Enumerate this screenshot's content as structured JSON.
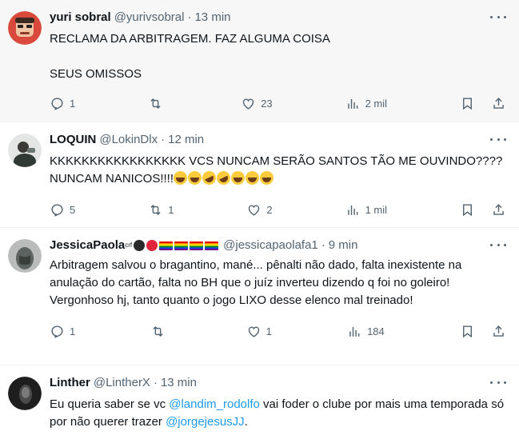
{
  "tweets": [
    {
      "name": "yuri sobral",
      "handle": "@yurivsobral",
      "sep": "·",
      "time": "13 min",
      "text": "RECLAMA DA ARBITRAGEM. FAZ ALGUMA COISA\n\nSEUS OMISSOS",
      "replies": "1",
      "retweets": "",
      "likes": "23",
      "views": "2 mil",
      "avatar_color": "#c9302c"
    },
    {
      "name": "LOQUIN",
      "handle": "@LokinDlx",
      "sep": "·",
      "time": "12 min",
      "text": "KKKKKKKKKKKKKKKKK VCS NUNCAM SERÃO SANTOS TÃO ME OUVINDO???? NUNCAM NANICOS!!!!",
      "replies": "5",
      "retweets": "1",
      "likes": "2",
      "views": "1 mil",
      "avatar_color": "#6f7a76"
    },
    {
      "name": "JessicaPaola",
      "name_sup": "crf",
      "handle": "@jessicapaolafa1",
      "sep": "·",
      "time": "9 min",
      "text": "Arbitragem salvou o bragantino, mané... pênalti não dado, falta inexistente na anulação do cartão, falta no BH que o juíz inverteu dizendo q foi no goleiro! Vergonhoso hj, tanto quanto o jogo LIXO desse elenco mal treinado!",
      "replies": "1",
      "retweets": "",
      "likes": "1",
      "views": "184",
      "avatar_color": "#8a8f8c"
    },
    {
      "name": "Linther",
      "handle": "@LintherX",
      "sep": "·",
      "time": "13 min",
      "text_parts": {
        "a": "Eu queria saber se vc ",
        "m1": "@landim_rodolfo",
        "b": " vai foder o clube por mais uma temporada só por não querer trazer ",
        "m2": "@jorgejesusJJ",
        "c": "."
      },
      "avatar_color": "#2b2b2b"
    }
  ],
  "colors": {
    "accent": "#1d9bf0",
    "muted": "#536471",
    "text": "#0f1419"
  },
  "icons": [
    "reply-icon",
    "retweet-icon",
    "like-icon",
    "views-icon",
    "bookmark-icon",
    "share-icon",
    "more-icon"
  ]
}
